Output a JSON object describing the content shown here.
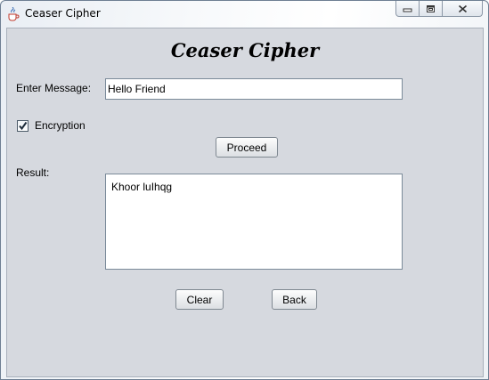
{
  "window": {
    "title": "Ceaser Cipher",
    "controls": {
      "minimize_icon": "minimize-icon",
      "maximize_icon": "maximize-icon",
      "close_icon": "close-icon"
    }
  },
  "form": {
    "heading": "Ceaser Cipher",
    "message_label": "Enter Message:",
    "message_value": "Hello Friend",
    "encryption_label": "Encryption",
    "encryption_checked": true,
    "proceed_label": "Proceed",
    "result_label": "Result:",
    "result_value": "Khoor luIhqg",
    "clear_label": "Clear",
    "back_label": "Back"
  },
  "colors": {
    "panel_background": "#d6d9df",
    "field_background": "#ffffff"
  }
}
